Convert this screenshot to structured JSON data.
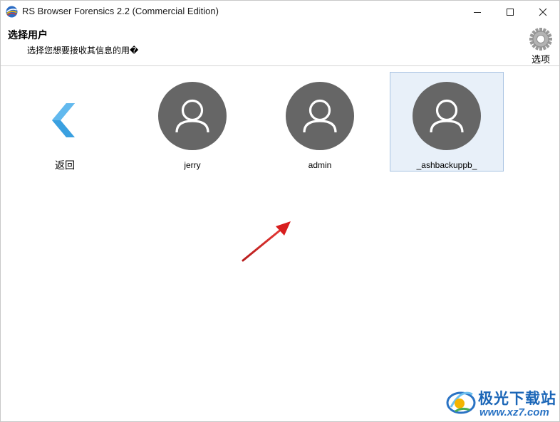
{
  "window": {
    "title": "RS Browser Forensics 2.2 (Commercial Edition)"
  },
  "header": {
    "title": "选择用户",
    "subtitle": "选择您想要接收其信息的用�",
    "options_label": "选项"
  },
  "tiles": {
    "back_label": "返回",
    "users": [
      {
        "name": "jerry",
        "selected": false
      },
      {
        "name": "admin",
        "selected": false
      },
      {
        "name": "_ashbackuppb_",
        "selected": true
      }
    ]
  },
  "colors": {
    "accent_back_arrow": "#3aa0e0",
    "avatar_bg": "#666666",
    "selection_bg": "#e8f0f9",
    "selection_border": "#a9c3e2",
    "annotation_arrow": "#d81e1e"
  },
  "watermark": {
    "title": "极光下载站",
    "url": "www.xz7.com"
  }
}
